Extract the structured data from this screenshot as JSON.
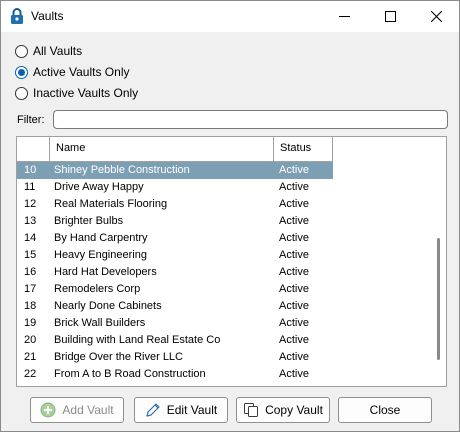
{
  "window": {
    "title": "Vaults"
  },
  "title_icon": "padlock-icon",
  "filter_mode": {
    "options": [
      {
        "label": "All Vaults",
        "checked": false
      },
      {
        "label": "Active Vaults Only",
        "checked": true
      },
      {
        "label": "Inactive Vaults Only",
        "checked": false
      }
    ]
  },
  "filter": {
    "label": "Filter:",
    "value": ""
  },
  "grid": {
    "columns": {
      "name": "Name",
      "status": "Status"
    },
    "selected_id": "10",
    "rows": [
      {
        "id": "10",
        "name": "Shiney Pebble Construction",
        "status": "Active"
      },
      {
        "id": "11",
        "name": "Drive Away Happy",
        "status": "Active"
      },
      {
        "id": "12",
        "name": "Real Materials Flooring",
        "status": "Active"
      },
      {
        "id": "13",
        "name": "Brighter Bulbs",
        "status": "Active"
      },
      {
        "id": "14",
        "name": "By Hand Carpentry",
        "status": "Active"
      },
      {
        "id": "15",
        "name": "Heavy Engineering",
        "status": "Active"
      },
      {
        "id": "16",
        "name": "Hard Hat Developers",
        "status": "Active"
      },
      {
        "id": "17",
        "name": "Remodelers Corp",
        "status": "Active"
      },
      {
        "id": "18",
        "name": "Nearly Done Cabinets",
        "status": "Active"
      },
      {
        "id": "19",
        "name": "Brick Wall Builders",
        "status": "Active"
      },
      {
        "id": "20",
        "name": "Building with Land Real Estate Co",
        "status": "Active"
      },
      {
        "id": "21",
        "name": "Bridge Over the River LLC",
        "status": "Active"
      },
      {
        "id": "22",
        "name": "From A to B Road Construction",
        "status": "Active"
      }
    ]
  },
  "buttons": {
    "add": {
      "label": "Add Vault",
      "icon": "plus-circle-icon",
      "enabled": false
    },
    "edit": {
      "label": "Edit Vault",
      "icon": "pencil-icon",
      "enabled": true
    },
    "copy": {
      "label": "Copy Vault",
      "icon": "copy-icon",
      "enabled": true
    },
    "close": {
      "label": "Close",
      "enabled": true
    }
  },
  "colors": {
    "selection": "#7d9fb4",
    "radio_accent": "#0a5fb4"
  }
}
